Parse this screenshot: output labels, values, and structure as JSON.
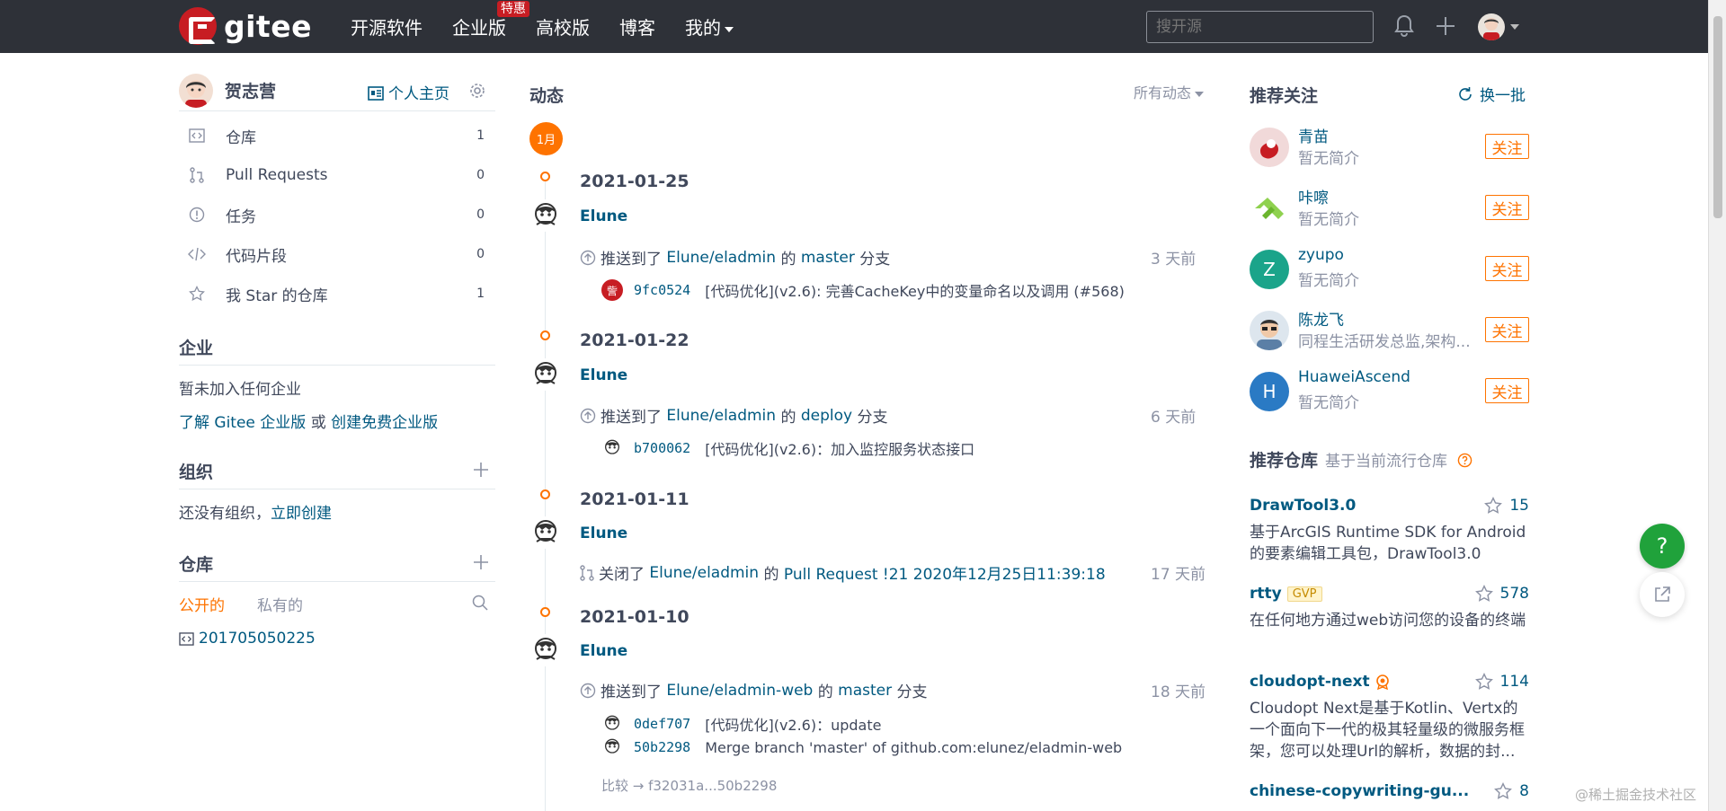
{
  "topbar": {
    "logo_text": "gitee",
    "nav": [
      {
        "label": "开源软件"
      },
      {
        "label": "企业版",
        "badge": "特惠"
      },
      {
        "label": "高校版"
      },
      {
        "label": "博客"
      },
      {
        "label": "我的"
      }
    ],
    "search_placeholder": "搜开源"
  },
  "left": {
    "user_name": "贺志营",
    "home_link": "个人主页",
    "items": [
      {
        "label": "仓库",
        "count": "1"
      },
      {
        "label": "Pull Requests",
        "count": "0"
      },
      {
        "label": "任务",
        "count": "0"
      },
      {
        "label": "代码片段",
        "count": "0"
      },
      {
        "label": "我 Star 的仓库",
        "count": "1"
      }
    ],
    "enterprise_title": "企业",
    "enterprise_text": "暂未加入任何企业",
    "enterprise_link1": "了解 Gitee 企业版",
    "enterprise_or": "或",
    "enterprise_link2": "创建免费企业版",
    "org_title": "组织",
    "org_text": "还没有组织，",
    "org_link": "立即创建",
    "repo_title": "仓库",
    "repo_tab_public": "公开的",
    "repo_tab_private": "私有的",
    "repo_item": "201705050225"
  },
  "feed": {
    "title": "动态",
    "filter": "所有动态",
    "month": "1月",
    "groups": [
      {
        "date": "2021-01-25",
        "actor": "Elune",
        "action": "推送到了",
        "repo": "Elune/eladmin",
        "mid": "的",
        "branch": "master",
        "tail": "分支",
        "ago": "3 天前",
        "commits": [
          {
            "sha": "9fc0524",
            "msg": "[代码优化](v2.6): 完善CacheKey中的变量命名以及调用 (#568)",
            "avatar": "訾"
          }
        ]
      },
      {
        "date": "2021-01-22",
        "actor": "Elune",
        "action": "推送到了",
        "repo": "Elune/eladmin",
        "mid": "的",
        "branch": "deploy",
        "tail": "分支",
        "ago": "6 天前",
        "commits": [
          {
            "sha": "b700062",
            "msg": "[代码优化](v2.6)：加入监控服务状态接口"
          }
        ]
      },
      {
        "date": "2021-01-11",
        "actor": "Elune",
        "action": "关闭了",
        "repo": "Elune/eladmin",
        "mid": "的",
        "pr": "Pull Request !21 2020年12月25日11:39:18",
        "ago": "17 天前"
      },
      {
        "date": "2021-01-10",
        "actor": "Elune",
        "action": "推送到了",
        "repo": "Elune/eladmin-web",
        "mid": "的",
        "branch": "master",
        "tail": "分支",
        "ago": "18 天前",
        "commits": [
          {
            "sha": "0def707",
            "msg": "[代码优化](v2.6)：update"
          },
          {
            "sha": "50b2298",
            "msg": "Merge branch 'master' of github.com:elunez/eladmin-web"
          }
        ],
        "compare": "比较 → f32031a...50b2298"
      }
    ]
  },
  "right": {
    "follow_title": "推荐关注",
    "refresh": "换一批",
    "follow_btn": "关注",
    "users": [
      {
        "name": "青苗",
        "desc": "暂无简介"
      },
      {
        "name": "咔嚓",
        "desc": "暂无简介"
      },
      {
        "name": "zyupo",
        "desc": "暂无简介",
        "initial": "Z"
      },
      {
        "name": "陈龙飞",
        "desc": "同程生活研发总监,架构..."
      },
      {
        "name": "HuaweiAscend",
        "desc": "暂无简介",
        "initial": "H"
      }
    ],
    "repo_title": "推荐仓库",
    "repo_sub": "基于当前流行仓库",
    "repos": [
      {
        "name": "DrawTool3.0",
        "stars": "15",
        "desc": "基于ArcGIS Runtime SDK for Android的要素编辑工具包，DrawTool3.0"
      },
      {
        "name": "rtty",
        "badge": "GVP",
        "stars": "578",
        "desc": "在任何地方通过web访问您的设备的终端"
      },
      {
        "name": "cloudopt-next",
        "stars": "114",
        "desc": "Cloudopt Next是基于Kotlin、Vertx的一个面向下一代的极其轻量级的微服务框架，您可以处理Url的解析，数据的封..."
      },
      {
        "name": "chinese-copywriting-gu...",
        "stars": "8"
      }
    ]
  },
  "float": {
    "help": "?"
  },
  "watermark": "@稀土掘金技术社区",
  "colors": {
    "brand": "#c71d23",
    "accent": "#fe7300",
    "link": "#005980",
    "topbar": "#2e3138",
    "help": "#20a23b"
  }
}
